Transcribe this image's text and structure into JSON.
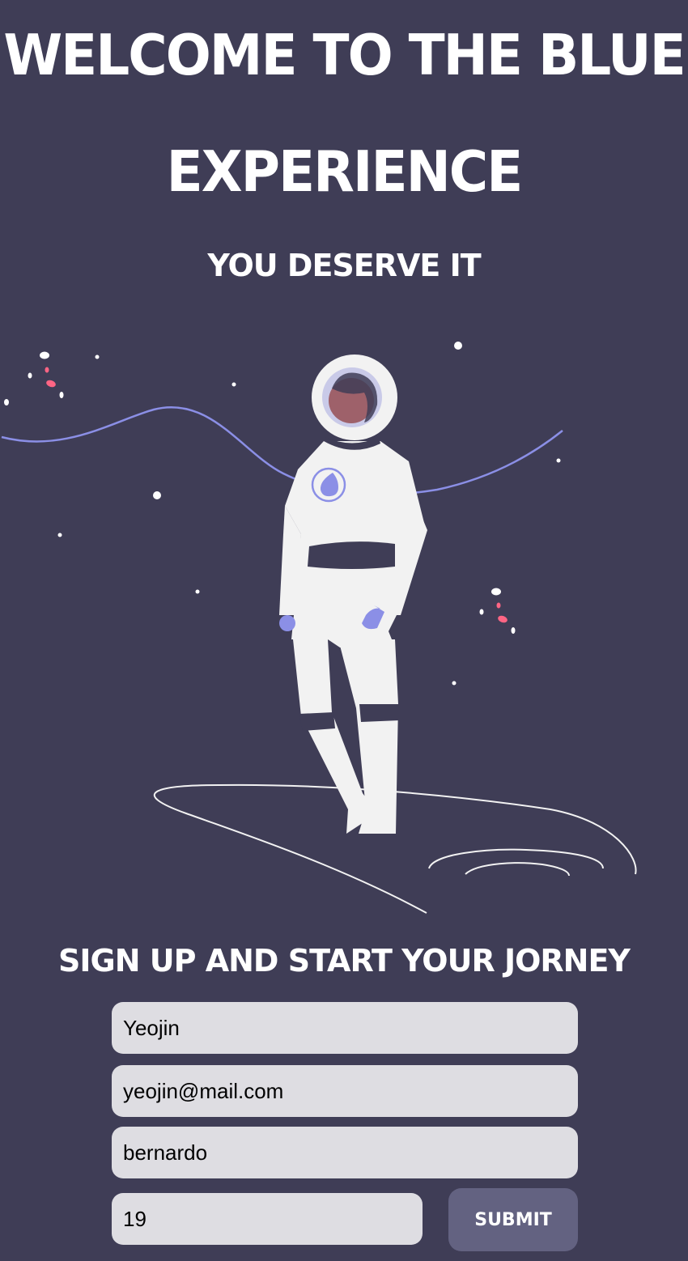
{
  "hero": {
    "title_line1": "Welcome to the blue",
    "title_line2": "experience",
    "subtitle": "You deserve it"
  },
  "illustration": {
    "icon": "astronaut-illustration",
    "colors": {
      "background": "#3f3d56",
      "suit": "#f2f2f2",
      "accent": "#8b8fe6",
      "face": "#9e616a",
      "star_pink": "#ff6584"
    }
  },
  "signup": {
    "heading": "Sign up and start your jorney",
    "name_value": "Yeojin",
    "email_value": "yeojin@mail.com",
    "password_value": "bernardo",
    "age_value": "19",
    "submit_label": "Submit"
  }
}
